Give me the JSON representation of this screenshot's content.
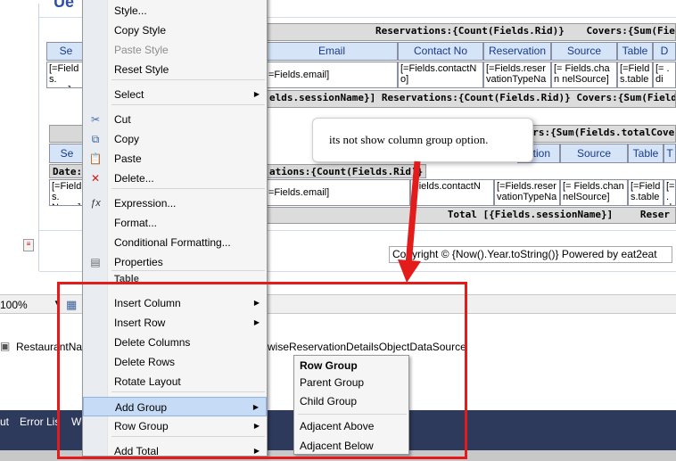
{
  "report": {
    "title_fragment": "Ue",
    "header_reservations": "Reservations:{Count(Fields.Rid)}",
    "header_covers": "Covers:{Sum(Fields.tot",
    "col_headers": [
      "Se",
      "Email",
      "Contact No",
      "Reservation",
      "Source",
      "Table",
      "D"
    ],
    "row1_cells": [
      "[=Fields.\name]",
      "=Fields.email]",
      "[=Fields.contactN o]",
      "[=Fields.reser vationTypeNa",
      "[= Fields.chan nelSource]",
      "[=Field s.table",
      "[= .di"
    ],
    "group_header_1": "elds.sessionName}]   Reservations:{Count(Fields.Rid)}   Covers:{Sum(Fields.tot",
    "inner_header_covers": "vers:{Sum(Fields.totalCovers)}",
    "inner_col_headers": [
      "Se",
      "ation",
      "Source",
      "Table",
      "T"
    ],
    "date_row": "Date:",
    "date_row_right": "ations:{Count(Fields.Rid)}",
    "row2_cells": [
      "[=Fields.\nName]",
      "=Fields.email]",
      "Fields.contactN",
      "[=Fields.reser vationTypeNa",
      "[= Fields.chan nelSource]",
      "[=Field s.table",
      "[= .di"
    ],
    "total_row": "Total [{Fields.sessionName}]",
    "total_right": "Reser",
    "footer_text": "Copyright © {Now().Year.toString()} Powered by eat2eat"
  },
  "toolbar": {
    "zoom": "100%"
  },
  "datasource_row": {
    "left": "RestaurantNa",
    "right": "ntwiseReservationDetailsObjectDataSource"
  },
  "bottom_panel": {
    "items": [
      "ut",
      "Error Lis",
      "W"
    ]
  },
  "context_menu": {
    "items": [
      {
        "label": "Style...",
        "disabled": false,
        "submenu": false,
        "icon": ""
      },
      {
        "label": "Copy Style",
        "disabled": false,
        "submenu": false,
        "icon": ""
      },
      {
        "label": "Paste Style",
        "disabled": true,
        "submenu": false,
        "icon": ""
      },
      {
        "label": "Reset Style",
        "disabled": false,
        "submenu": false,
        "icon": ""
      },
      {
        "label": "Select",
        "disabled": false,
        "submenu": true,
        "icon": ""
      },
      {
        "label": "Cut",
        "disabled": false,
        "submenu": false,
        "icon": "scissors-icon"
      },
      {
        "label": "Copy",
        "disabled": false,
        "submenu": false,
        "icon": "copy-icon"
      },
      {
        "label": "Paste",
        "disabled": false,
        "submenu": false,
        "icon": "paste-icon"
      },
      {
        "label": "Delete...",
        "disabled": false,
        "submenu": false,
        "icon": "delete-icon"
      },
      {
        "label": "Expression...",
        "disabled": false,
        "submenu": false,
        "icon": "fx-icon"
      },
      {
        "label": "Format...",
        "disabled": false,
        "submenu": false,
        "icon": ""
      },
      {
        "label": "Conditional Formatting...",
        "disabled": false,
        "submenu": false,
        "icon": ""
      },
      {
        "label": "Properties",
        "disabled": false,
        "submenu": false,
        "icon": "properties-icon"
      },
      {
        "label": "Table",
        "disabled": false,
        "submenu": false,
        "icon": "",
        "heading": true
      },
      {
        "label": "Insert Column",
        "disabled": false,
        "submenu": true,
        "icon": ""
      },
      {
        "label": "Insert Row",
        "disabled": false,
        "submenu": true,
        "icon": ""
      },
      {
        "label": "Delete Columns",
        "disabled": false,
        "submenu": false,
        "icon": ""
      },
      {
        "label": "Delete Rows",
        "disabled": false,
        "submenu": false,
        "icon": ""
      },
      {
        "label": "Rotate Layout",
        "disabled": false,
        "submenu": false,
        "icon": ""
      },
      {
        "label": "Add Group",
        "disabled": false,
        "submenu": true,
        "icon": "",
        "highlighted": true
      },
      {
        "label": "Row Group",
        "disabled": false,
        "submenu": true,
        "icon": ""
      },
      {
        "label": "Add Total",
        "disabled": false,
        "submenu": true,
        "icon": ""
      }
    ]
  },
  "submenu": {
    "heading": "Row Group",
    "items": [
      "Parent Group",
      "Child Group",
      "Adjacent Above",
      "Adjacent Below"
    ]
  },
  "annotation": {
    "callout_text": "its not show column group option.",
    "color": "#e31b1b"
  }
}
